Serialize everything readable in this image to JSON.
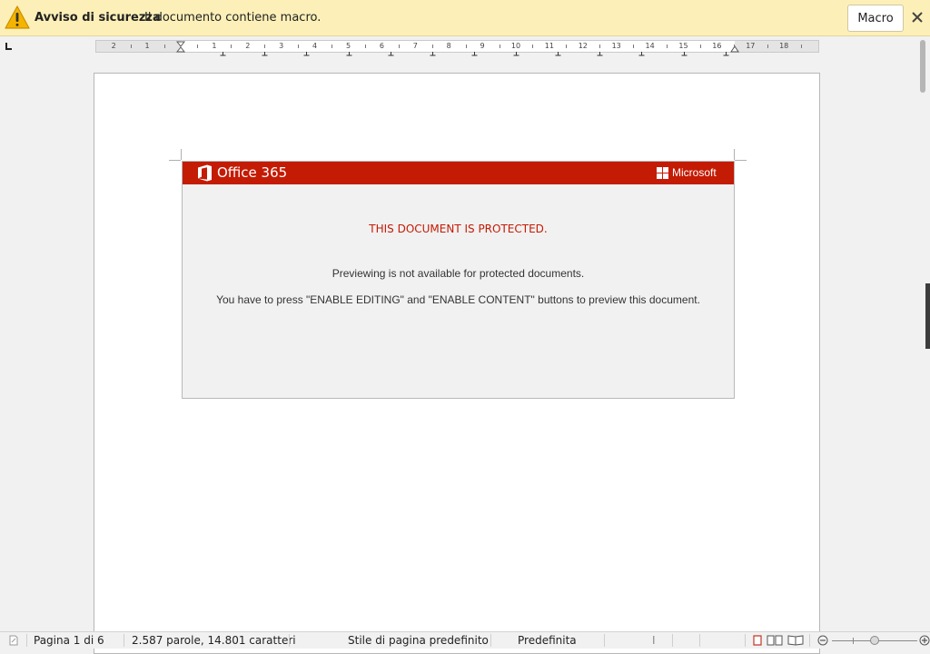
{
  "infobar": {
    "title": "Avviso di sicurezza",
    "message": "Il documento contiene macro.",
    "macro_button": "Macro",
    "icon": "warning-icon",
    "close_icon": "close-icon"
  },
  "ruler": {
    "labels": [
      "2",
      "1",
      "1",
      "2",
      "3",
      "4",
      "5",
      "6",
      "7",
      "8",
      "9",
      "10",
      "11",
      "12",
      "13",
      "14",
      "15",
      "16",
      "17",
      "18"
    ]
  },
  "embedded_image": {
    "brand": "Office 365",
    "vendor": "Microsoft",
    "headline": "THIS DOCUMENT IS PROTECTED.",
    "line1": "Previewing is not available for protected documents.",
    "line2": "You have to press \"ENABLE EDITING\" and \"ENABLE CONTENT\" buttons to preview this document.",
    "bar_color": "#c41b04"
  },
  "statusbar": {
    "page": "Pagina 1 di 6",
    "words": "2.587 parole, 14.801 caratteri",
    "page_style": "Stile di pagina predefinito",
    "language": "Predefinita",
    "insert_mode": "I",
    "view_icons": [
      "single-page-view-icon",
      "multi-page-view-icon",
      "book-view-icon"
    ],
    "zoom_out": "zoom-out-icon",
    "zoom_in": "zoom-in-icon"
  }
}
